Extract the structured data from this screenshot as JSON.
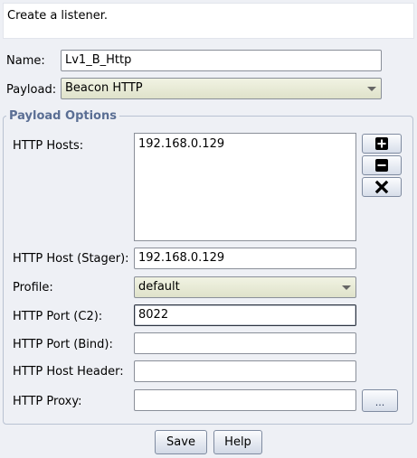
{
  "description": "Create a listener.",
  "form": {
    "name_label": "Name:",
    "name_value": "Lv1_B_Http",
    "payload_label": "Payload:",
    "payload_value": "Beacon HTTP"
  },
  "payload_options": {
    "title": "Payload Options",
    "hosts_label": "HTTP Hosts:",
    "hosts": [
      "192.168.0.129"
    ],
    "stager_label": "HTTP Host (Stager):",
    "stager_value": "192.168.0.129",
    "profile_label": "Profile:",
    "profile_value": "default",
    "port_c2_label": "HTTP Port (C2):",
    "port_c2_value": "8022",
    "port_bind_label": "HTTP Port (Bind):",
    "port_bind_value": "",
    "host_header_label": "HTTP Host Header:",
    "host_header_value": "",
    "proxy_label": "HTTP Proxy:",
    "proxy_value": "",
    "proxy_button_label": "..."
  },
  "buttons": {
    "save": "Save",
    "help": "Help"
  },
  "icons": {
    "add": "plus-icon",
    "remove": "minus-icon",
    "clear": "x-icon"
  }
}
